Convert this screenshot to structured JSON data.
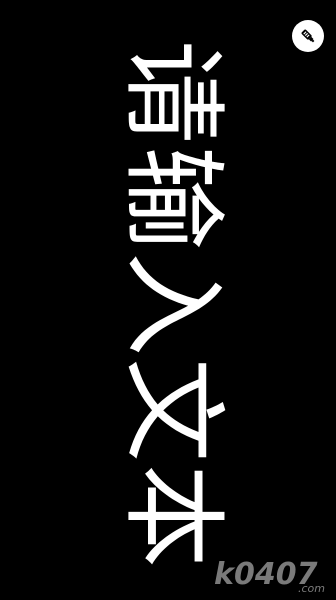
{
  "marquee": {
    "text": "请输入文本"
  },
  "controls": {
    "rotate_button_icon": "rocket-speaker-icon"
  },
  "watermark": {
    "logo_text": "k0407",
    "logo_suffix": ".com"
  },
  "colors": {
    "background": "#000000",
    "text": "#ffffff",
    "button_bg": "#ffffff",
    "button_icon": "#000000",
    "watermark": "#7a7a7a"
  }
}
